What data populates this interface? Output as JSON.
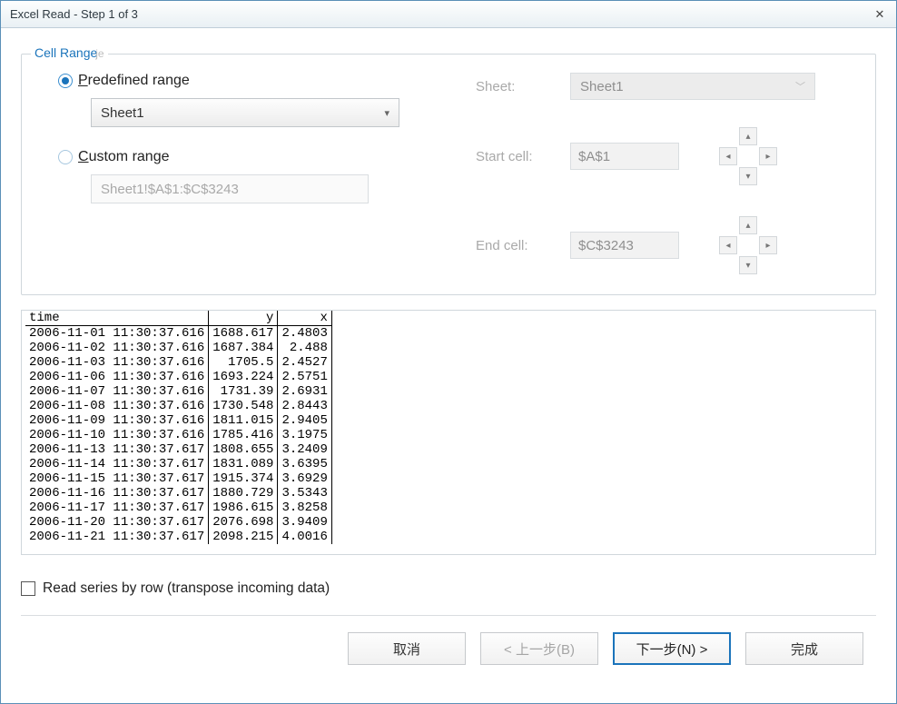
{
  "window": {
    "title": "Excel Read - Step 1 of 3"
  },
  "fieldset": {
    "legend": "Cell Range",
    "legend_stray": "je",
    "predefined": {
      "label_pre": "P",
      "label_post": "redefined range",
      "selected": true
    },
    "custom": {
      "label_pre": "C",
      "label_post": "ustom range",
      "selected": false
    },
    "sheet_combo": "Sheet1",
    "custom_value": "Sheet1!$A$1:$C$3243"
  },
  "right": {
    "sheet_label": "Sheet:",
    "sheet_value": "Sheet1",
    "start_label": "Start cell:",
    "start_value": "$A$1",
    "end_label": "End cell:",
    "end_value": "$C$3243"
  },
  "preview": {
    "headers": [
      "time",
      "y",
      "x"
    ],
    "rows": [
      [
        "2006-11-01 11:30:37.616",
        "1688.617",
        "2.4803"
      ],
      [
        "2006-11-02 11:30:37.616",
        "1687.384",
        "2.488"
      ],
      [
        "2006-11-03 11:30:37.616",
        "1705.5",
        "2.4527"
      ],
      [
        "2006-11-06 11:30:37.616",
        "1693.224",
        "2.5751"
      ],
      [
        "2006-11-07 11:30:37.616",
        "1731.39",
        "2.6931"
      ],
      [
        "2006-11-08 11:30:37.616",
        "1730.548",
        "2.8443"
      ],
      [
        "2006-11-09 11:30:37.616",
        "1811.015",
        "2.9405"
      ],
      [
        "2006-11-10 11:30:37.616",
        "1785.416",
        "3.1975"
      ],
      [
        "2006-11-13 11:30:37.617",
        "1808.655",
        "3.2409"
      ],
      [
        "2006-11-14 11:30:37.617",
        "1831.089",
        "3.6395"
      ],
      [
        "2006-11-15 11:30:37.617",
        "1915.374",
        "3.6929"
      ],
      [
        "2006-11-16 11:30:37.617",
        "1880.729",
        "3.5343"
      ],
      [
        "2006-11-17 11:30:37.617",
        "1986.615",
        "3.8258"
      ],
      [
        "2006-11-20 11:30:37.617",
        "2076.698",
        "3.9409"
      ],
      [
        "2006-11-21 11:30:37.617",
        "2098.215",
        "4.0016"
      ]
    ]
  },
  "transpose": {
    "label": "Read series by row (transpose incoming data)",
    "checked": false
  },
  "buttons": {
    "cancel": "取消",
    "back": "< 上一步(B)",
    "next": "下一步(N) >",
    "finish": "完成"
  },
  "watermark": ""
}
